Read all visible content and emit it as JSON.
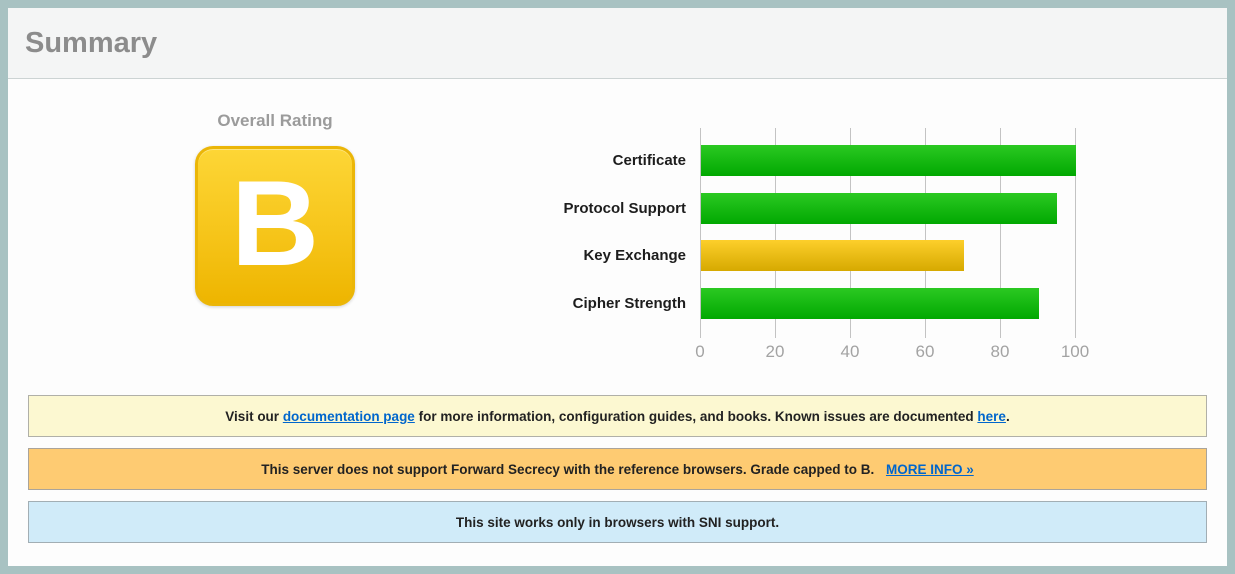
{
  "header": {
    "title": "Summary"
  },
  "rating": {
    "label": "Overall Rating",
    "grade": "B"
  },
  "chart_data": {
    "type": "bar",
    "orientation": "horizontal",
    "title": "",
    "categories": [
      "Certificate",
      "Protocol Support",
      "Key Exchange",
      "Cipher Strength"
    ],
    "values": [
      100,
      95,
      70,
      90
    ],
    "colors": [
      "green",
      "green",
      "yellow",
      "green"
    ],
    "xlim": [
      0,
      100
    ],
    "x_ticks": [
      0,
      20,
      40,
      60,
      80,
      100
    ],
    "grid": true,
    "legend": false,
    "bar_colors": {
      "green": {
        "top": "#2bc922",
        "bottom": "#01a801"
      },
      "yellow": {
        "top": "#fdcf2b",
        "bottom": "#d6a900"
      }
    },
    "gridline_color": "#c3c3c3",
    "tick_label_color": "#a3a3a3"
  },
  "notice_styles": {
    "yellow": {
      "bg": "#fcf8d1",
      "border": "#b0b0a8"
    },
    "orange": {
      "bg": "#fecb72",
      "border": "#aaa49a"
    },
    "blue": {
      "bg": "#d0ebf9",
      "border": "#a2aeb4"
    }
  },
  "link_color": "#0066cc",
  "notices": [
    {
      "name": "notice-documentation",
      "style": "yellow",
      "segments": [
        {
          "text": "Visit our "
        },
        {
          "text": "documentation page",
          "link": true,
          "name": "documentation-page-link"
        },
        {
          "text": " for more information, configuration guides, and books. Known issues are documented "
        },
        {
          "text": "here",
          "link": true,
          "name": "known-issues-here-link"
        },
        {
          "text": "."
        }
      ]
    },
    {
      "name": "notice-forward-secrecy",
      "style": "orange",
      "segments": [
        {
          "text": "This server does not support Forward Secrecy with the reference browsers. Grade capped to B. "
        },
        {
          "text": "MORE INFO »",
          "link": true,
          "spaced": true,
          "name": "more-info-link"
        }
      ]
    },
    {
      "name": "notice-sni",
      "style": "blue",
      "segments": [
        {
          "text": "This site works only in browsers with SNI support."
        }
      ]
    }
  ]
}
